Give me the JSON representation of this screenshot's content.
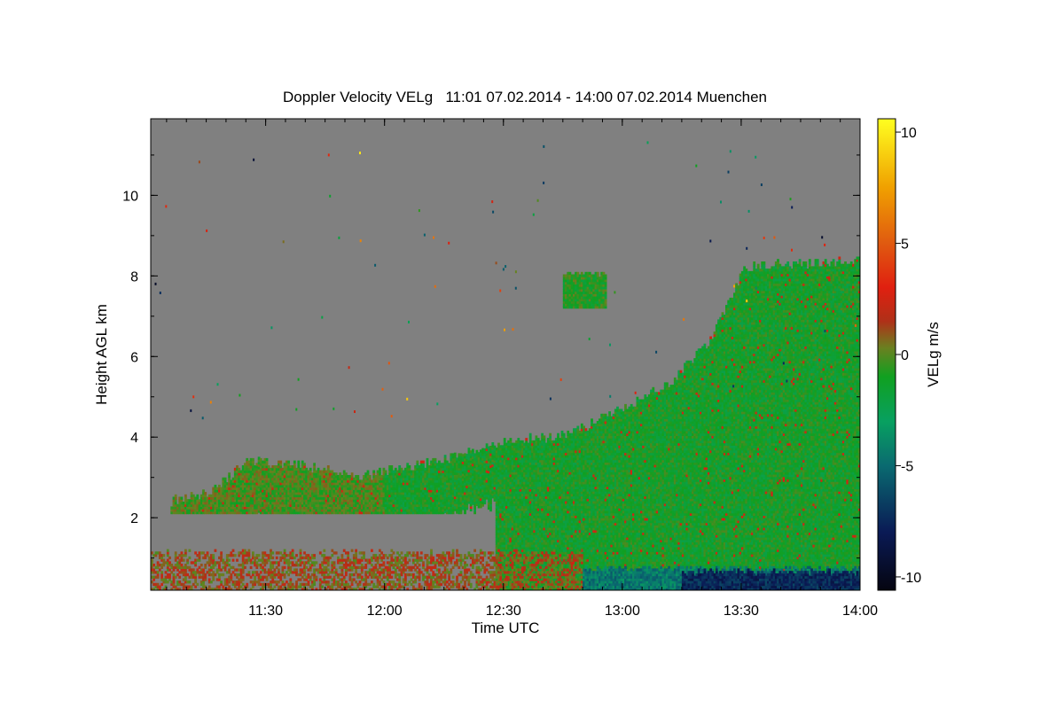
{
  "chart_data": {
    "type": "heatmap",
    "title": "Doppler Velocity VELg   11:01 07.02.2014 - 14:00 07.02.2014 Muenchen",
    "xlabel": "Time UTC",
    "ylabel": "Height AGL km",
    "colorbar_label": "VELg m/s",
    "x_start": "11:01",
    "x_end": "14:00",
    "xlim_minutes_utc": [
      661,
      840
    ],
    "ylim_km": [
      0.2,
      11.9
    ],
    "x_ticks": [
      {
        "label": "11:30",
        "minute": 690
      },
      {
        "label": "12:00",
        "minute": 720
      },
      {
        "label": "12:30",
        "minute": 750
      },
      {
        "label": "13:00",
        "minute": 780
      },
      {
        "label": "13:30",
        "minute": 810
      },
      {
        "label": "14:00",
        "minute": 840
      }
    ],
    "y_ticks": [
      {
        "label": "2",
        "value": 2
      },
      {
        "label": "4",
        "value": 4
      },
      {
        "label": "6",
        "value": 6
      },
      {
        "label": "8",
        "value": 8
      },
      {
        "label": "10",
        "value": 10
      }
    ],
    "colorbar_range": [
      -10.6,
      10.6
    ],
    "colorbar_ticks": [
      {
        "label": "10",
        "value": 10
      },
      {
        "label": "5",
        "value": 5
      },
      {
        "label": "0",
        "value": 0
      },
      {
        "label": "-5",
        "value": -5
      },
      {
        "label": "-10",
        "value": -10
      }
    ],
    "colormap": [
      {
        "v": -10.6,
        "color": "#050510"
      },
      {
        "v": -8.0,
        "color": "#0a1a55"
      },
      {
        "v": -5.0,
        "color": "#0a6a70"
      },
      {
        "v": -3.0,
        "color": "#08a060"
      },
      {
        "v": -1.0,
        "color": "#10a020"
      },
      {
        "v": 0.3,
        "color": "#6a8020"
      },
      {
        "v": 1.5,
        "color": "#b03018"
      },
      {
        "v": 3.0,
        "color": "#e02010"
      },
      {
        "v": 5.0,
        "color": "#e05a10"
      },
      {
        "v": 7.5,
        "color": "#f0a000"
      },
      {
        "v": 10.6,
        "color": "#ffff20"
      }
    ],
    "no_data_color": "#808080",
    "cloud_regions": [
      {
        "name": "mid-level cloud top",
        "minute_start": 666,
        "minute_end": 840,
        "top_km": [
          2.4,
          2.6,
          3.4,
          3.3,
          3.2,
          3.0,
          3.2,
          3.4,
          3.7,
          3.9,
          4.0,
          4.3,
          4.8,
          5.3,
          6.3,
          8.2,
          8.3,
          8.3,
          8.4
        ],
        "velocity_ms": -1.2
      },
      {
        "name": "upper cloud patch",
        "minute_start": 765,
        "minute_end": 776,
        "base_km": 7.2,
        "top_km": 8.1,
        "velocity_ms": -0.8
      },
      {
        "name": "low drizzle layer",
        "minute_start": 661,
        "minute_end": 770,
        "base_km": 0.2,
        "top_km": 1.2,
        "velocity_ms": 1.0
      },
      {
        "name": "near-surface fall band",
        "minute_start": 770,
        "minute_end": 840,
        "base_km": 0.2,
        "top_km": 0.8,
        "velocity_ms": -4.5
      },
      {
        "name": "strong fall core",
        "minute_start": 795,
        "minute_end": 840,
        "base_km": 0.2,
        "top_km": 0.7,
        "velocity_ms": -7.5
      }
    ]
  }
}
